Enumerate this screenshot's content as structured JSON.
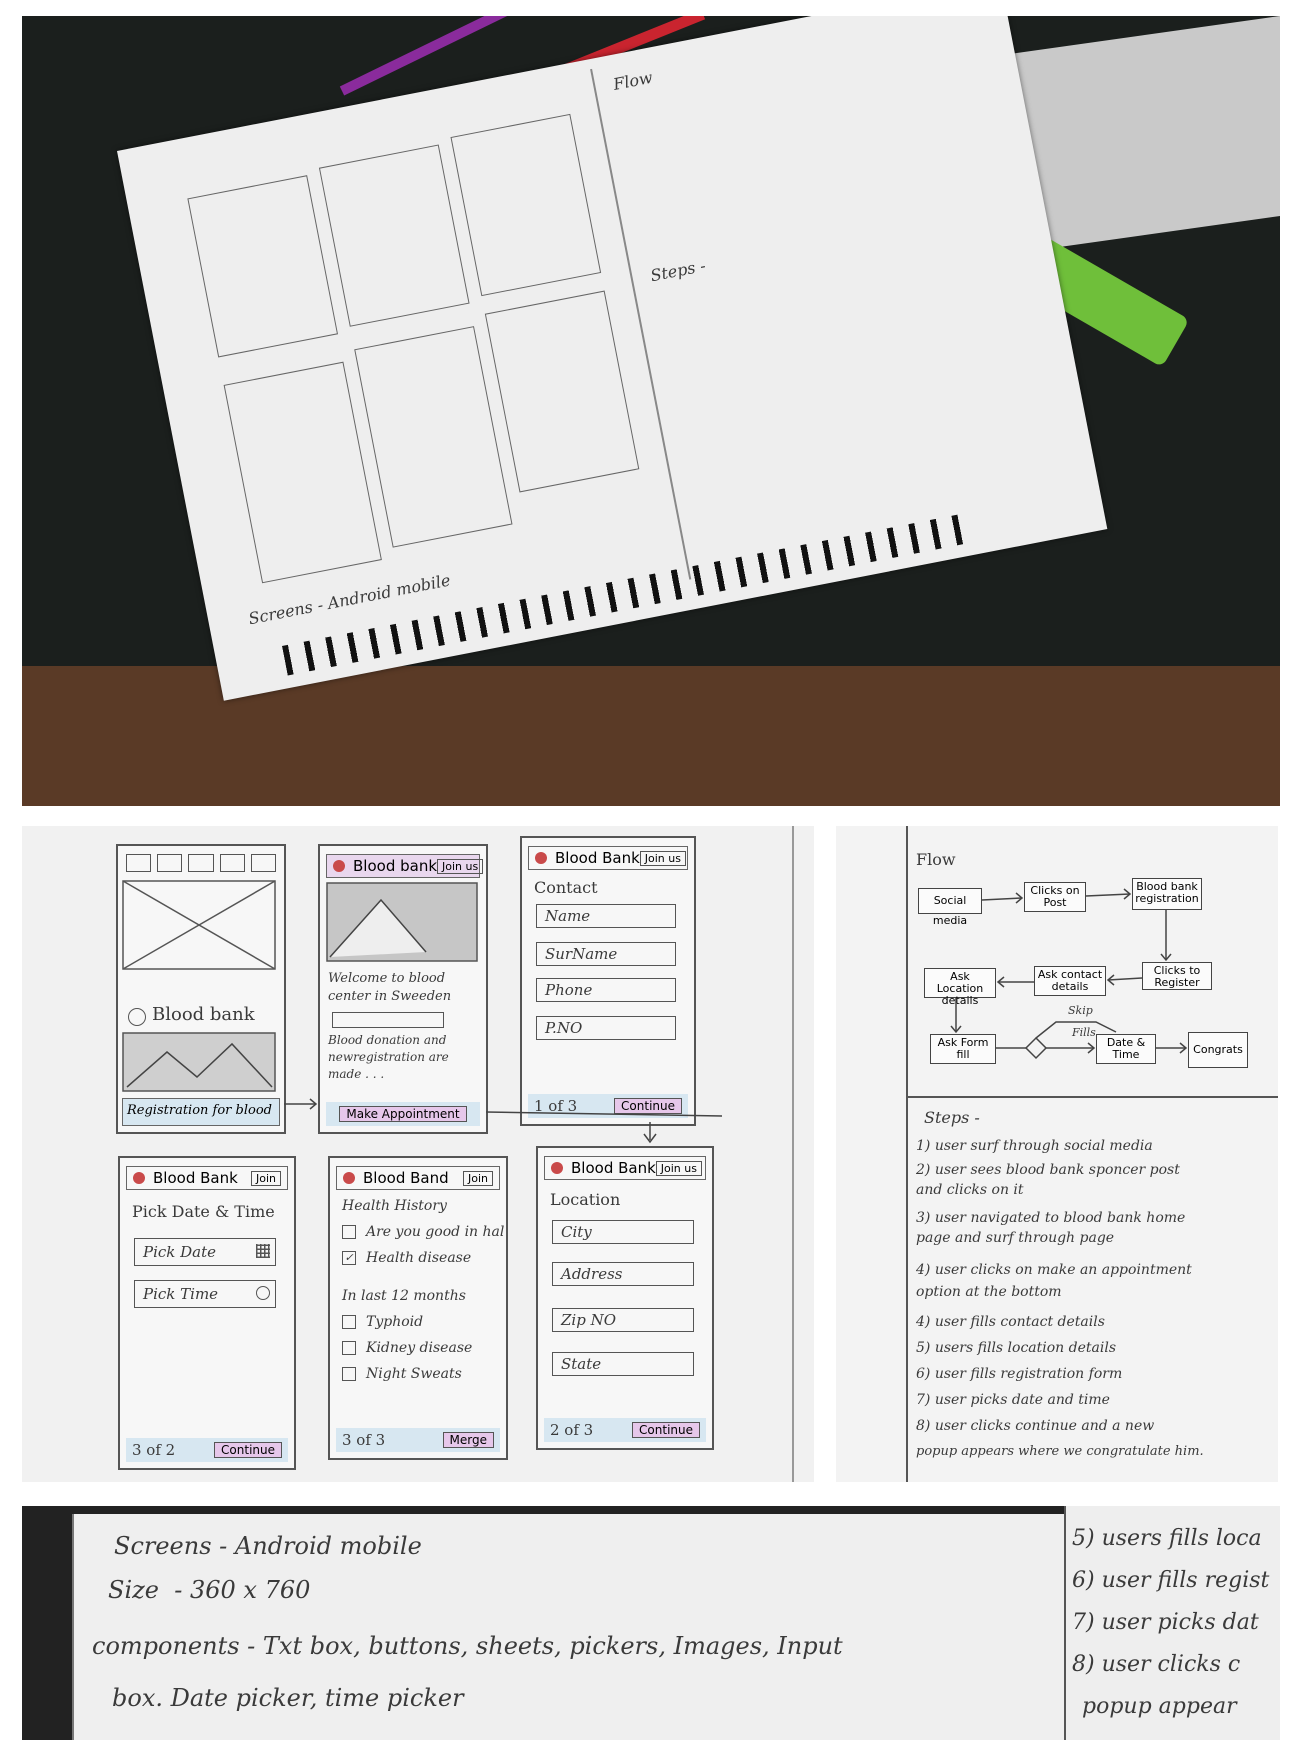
{
  "photo_top": {
    "description_alt": "",
    "flow_title": "Flow",
    "steps_title": "Steps -",
    "screens_line": "Screens - Android mobile"
  },
  "screens": {
    "home": {
      "title": "Blood bank",
      "footer": "Registration for blood"
    },
    "welcome": {
      "header_title": "Blood bank",
      "join": "Join us",
      "text": "Welcome to blood center in Sweeden",
      "subtext": "Blood donation and newregistration are made . . .",
      "button": "Make Appointment"
    },
    "contact": {
      "header_title": "Blood Bank",
      "join": "Join us",
      "section": "Contact",
      "fields": [
        "Name",
        "SurName",
        "Phone",
        "P.NO"
      ],
      "page": "1 of 3",
      "button": "Continue"
    },
    "pick": {
      "header_title": "Blood Bank",
      "join": "Join",
      "section": "Pick Date & Time",
      "fields": [
        "Pick Date",
        "Pick Time"
      ],
      "page": "3 of 2",
      "button": "Continue"
    },
    "health": {
      "header_title": "Blood Band",
      "join": "Join",
      "section": "Health History",
      "checks": [
        "Are you good in hal",
        "Health disease"
      ],
      "sub": "In last 12 months",
      "checks2": [
        "Typhoid",
        "Kidney disease",
        "Night Sweats"
      ],
      "page": "3 of 3",
      "button": "Merge"
    },
    "location": {
      "header_title": "Blood Bank",
      "join": "Join us",
      "section": "Location",
      "fields": [
        "City",
        "Address",
        "Zip NO",
        "State"
      ],
      "page": "2 of 3",
      "button": "Continue"
    }
  },
  "flow": {
    "title": "Flow",
    "boxes": [
      "Social media",
      "Clicks on Post",
      "Blood bank registration",
      "Clicks to Register",
      "Ask contact details",
      "Ask Location details",
      "Ask Form fill",
      "Date & Time",
      "Congrats"
    ],
    "labels": [
      "Skip",
      "Fills"
    ]
  },
  "steps": {
    "title": "Steps -",
    "items": [
      "1) user surf through social media",
      "2) user sees blood bank sponcer post",
      "   and clicks on it",
      "3) user navigated to blood bank home",
      "   page and surf through page",
      "4) user clicks on make an appointment",
      "   option at the bottom",
      "4) user fills contact details",
      "5) users fills location details",
      "6) user fills registration form",
      "7) user picks date and time",
      "8) user clicks continue and a new",
      "   popup appears where we congratulate him."
    ]
  },
  "notes": {
    "line1": "Screens - Android mobile",
    "line2": "Size  - 360 x 760",
    "line3": "components - Txt box, buttons, sheets, pickers, Images, Input",
    "line4": "box. Date picker, time picker",
    "side": [
      "5) users fills loca",
      "6) user fills regist",
      "7) user picks dat",
      "8) user clicks c",
      "popup appear"
    ]
  }
}
